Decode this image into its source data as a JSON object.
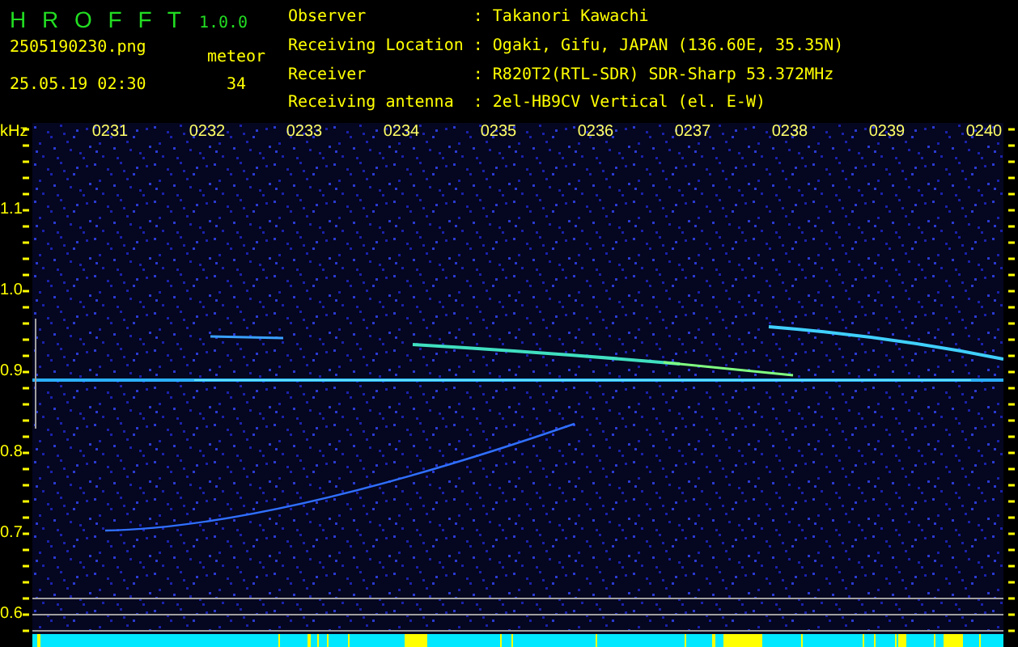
{
  "header": {
    "app_title": "H R O F F T",
    "version": "1.0.0",
    "filename": "2505190230.png",
    "datetime": "25.05.19 02:30",
    "count_label": "meteor",
    "count": "34"
  },
  "station_info": [
    {
      "label": "Observer",
      "separator": ":",
      "value": "Takanori Kawachi"
    },
    {
      "label": "Receiving Location",
      "separator": ":",
      "value": "Ogaki, Gifu, JAPAN (136.60E, 35.35N)"
    },
    {
      "label": "Receiver",
      "separator": ":",
      "value": "R820T2(RTL-SDR) SDR-Sharp 53.372MHz"
    },
    {
      "label": "Receiving antenna",
      "separator": ":",
      "value": "2el-HB9CV Vertical (el. E-W)"
    }
  ],
  "spectrogram": {
    "unit": "kHz",
    "time_labels": [
      "0231",
      "0232",
      "0233",
      "0234",
      "0235",
      "0236",
      "0237",
      "0238",
      "0239",
      "0240"
    ],
    "freq_labels": [
      "1.1",
      "1.0",
      "0.9",
      "0.8",
      "0.7",
      "0.6"
    ]
  }
}
